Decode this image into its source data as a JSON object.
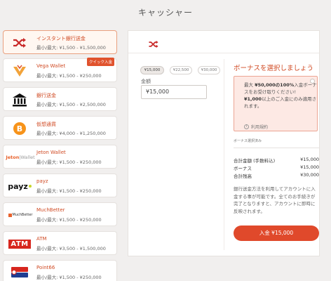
{
  "header": {
    "title": "キャッシャー"
  },
  "methods": [
    {
      "name": "インスタント銀行送金",
      "limit": "最小/最大: ¥1,500 - ¥1,500,000",
      "icon": "shuffle-icon",
      "active": true
    },
    {
      "name": "Vega Wallet",
      "limit": "最小/最大: ¥1,500 - ¥250,000",
      "icon": "vega-wallet-logo",
      "badge": "クイック入金"
    },
    {
      "name": "銀行送金",
      "limit": "最小/最大: ¥1,500 - ¥2,500,000",
      "icon": "bank-icon"
    },
    {
      "name": "仮想通貨",
      "limit": "最小/最大: ¥4,000 - ¥1,250,000",
      "icon": "bitcoin-icon"
    },
    {
      "name": "Jeton Wallet",
      "limit": "最小/最大: ¥1,500 - ¥250,000",
      "icon": "jeton-logo",
      "logo_text": "Jeton|Wallet"
    },
    {
      "name": "payz",
      "limit": "最小/最大: ¥1,500 - ¥250,000",
      "icon": "payz-logo",
      "logo_text": "payz"
    },
    {
      "name": "MuchBetter",
      "limit": "最小/最大: ¥1,500 - ¥250,000",
      "icon": "muchbetter-logo",
      "logo_text": "MuchBetter"
    },
    {
      "name": "ATM",
      "limit": "最小/最大: ¥3,500 - ¥1,500,000",
      "icon": "atm-logo",
      "logo_text": "ATM"
    },
    {
      "name": "Point66",
      "limit": "最小/最大: ¥1,500 - ¥250,000",
      "icon": "point66-logo"
    }
  ],
  "amount_chips": [
    "¥15,000",
    "¥22,500",
    "¥30,000"
  ],
  "amount_label": "金額",
  "amount_value": "¥15,000",
  "bonus": {
    "title": "ボーナスを選択しましょう",
    "line1_pre": "最大 ",
    "line1_bold": "¥50,000の100%",
    "line1_post": "入金ボーナスをお受け取りください!",
    "line2_bold": "¥1,000",
    "line2_post": "以上のご入金にのみ適用されます。",
    "terms": "利用規約",
    "selected_note": "ボーナス選択済み"
  },
  "summary": [
    {
      "label": "合計金額 (手数料込)",
      "value": "¥15,000"
    },
    {
      "label": "ボーナス",
      "value": "¥15,000"
    },
    {
      "label": "合計残高",
      "value": "¥30,000"
    }
  ],
  "note": "銀行送金方法を利用してアカウントに入金する事が可能です。全てのお手続きが完了となりますと、アカウントに即時に反映されます。",
  "deposit_button": "入金 ¥15,000",
  "colors": {
    "accent": "#e0492b",
    "brand_red": "#d04a23",
    "bonus_bg": "#fde9e4"
  }
}
